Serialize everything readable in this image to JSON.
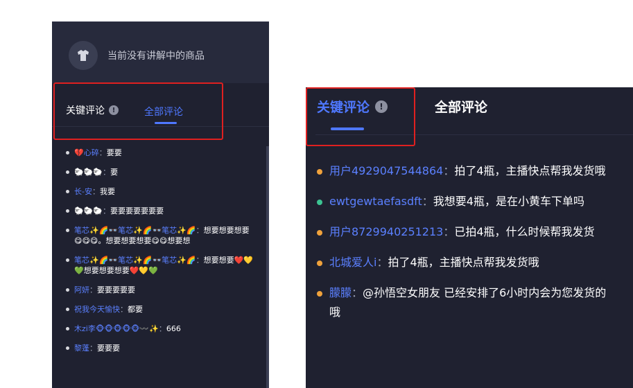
{
  "left": {
    "header_text": "当前没有讲解中的商品",
    "tabs": {
      "key": "关键评论",
      "all": "全部评论"
    },
    "comments": [
      {
        "user": "💔心碎",
        "sep": "：",
        "text": "要要"
      },
      {
        "user": "🐑🐑🐑",
        "sep": "：",
        "text": "要"
      },
      {
        "user": "长-安",
        "sep": "：",
        "text": "我要"
      },
      {
        "user": "🐑🐑🐑",
        "sep": "：",
        "text": "要要要要要要要"
      },
      {
        "user": "笔芯✨🌈👓笔芯✨🌈👓笔芯✨🌈",
        "sep": "：",
        "text": "想要想要想要😋😋😋。想要想要想要😋😋想要想"
      },
      {
        "user": "笔芯✨🌈👓笔芯✨🌈👓笔芯✨🌈",
        "sep": "：",
        "text": "想要想要❤️💛💚想要想要想要❤️💛💚"
      },
      {
        "user": "阿妍",
        "sep": "：",
        "text": "要要要要要"
      },
      {
        "user": "祝我今天愉快",
        "sep": "：",
        "text": "都要"
      },
      {
        "user": "木zi李🐵🐵🐵🐵🐵〰️✨",
        "sep": "：",
        "text": "666"
      },
      {
        "user": "黎蓬",
        "sep": "：",
        "text": "要要要"
      }
    ]
  },
  "right": {
    "tabs": {
      "key": "关键评论",
      "all": "全部评论"
    },
    "comments": [
      {
        "user": "用户4929047544864",
        "sep": "：",
        "text": "拍了4瓶，主播快点帮我发货哦",
        "dot": "#f0a23c"
      },
      {
        "user": "ewtgewtaefasdft",
        "sep": "：",
        "text": "我想要4瓶，是在小黄车下单吗",
        "dot": "#3cc492"
      },
      {
        "user": "用户8729940251213",
        "sep": "：",
        "text": "已拍4瓶，什么时候帮我发货",
        "dot": "#f0a23c"
      },
      {
        "user": "北城爱人i",
        "sep": "：",
        "text": "拍了4瓶，主播快点帮我发货哦",
        "dot": "#f0a23c"
      },
      {
        "user": "朦朦",
        "sep": "：",
        "text": "@孙悟空女朋友 已经安排了6小时内会为您发货的哦",
        "dot": "#f0a23c"
      }
    ]
  },
  "info_icon_glyph": "!",
  "colors": {
    "accent": "#4f78ff",
    "panel_bg": "#1f2130",
    "highlight": "#e02020"
  }
}
